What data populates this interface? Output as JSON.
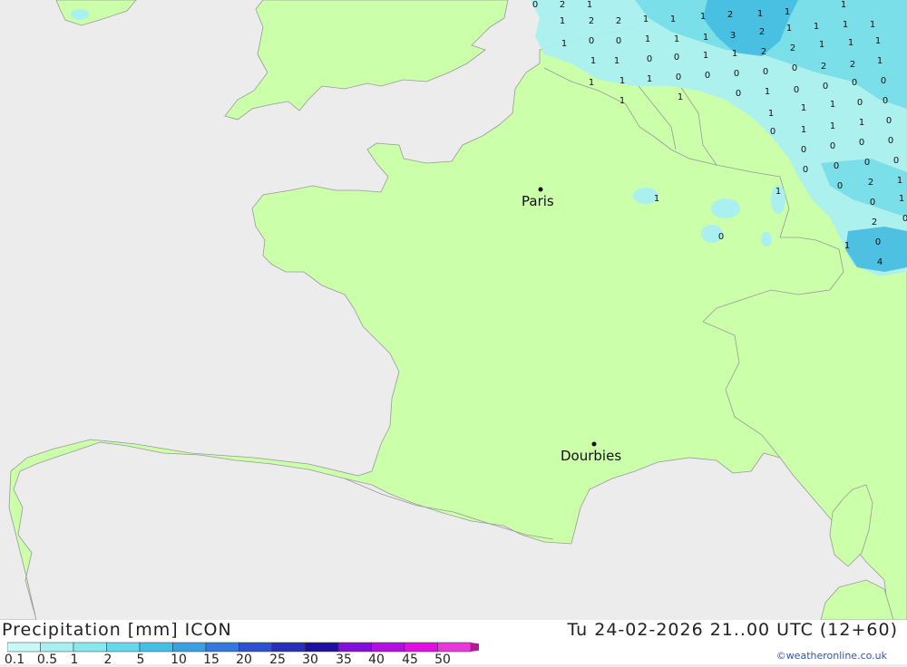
{
  "map": {
    "cities": [
      {
        "name": "Paris"
      },
      {
        "name": "Dourbies"
      }
    ],
    "precip_values": [
      "2",
      "1",
      "1",
      "2",
      "1",
      "1",
      "1",
      "2",
      "2",
      "1",
      "1",
      "0",
      "1",
      "1",
      "0",
      "0",
      "1",
      "1",
      "1",
      "3",
      "2",
      "1",
      "1",
      "1",
      "1",
      "1",
      "1",
      "0",
      "0",
      "1",
      "1",
      "2",
      "2",
      "1",
      "1",
      "1",
      "1",
      "1",
      "1",
      "0",
      "0",
      "0",
      "0",
      "0",
      "2",
      "2",
      "1",
      "1",
      "1",
      "0",
      "1",
      "0",
      "0",
      "0",
      "0",
      "1",
      "1",
      "1",
      "0",
      "0",
      "0",
      "1",
      "1",
      "1",
      "0",
      "0",
      "0",
      "0",
      "0",
      "0",
      "0",
      "0",
      "0",
      "0",
      "2",
      "1",
      "0",
      "1",
      "2",
      "0",
      "0",
      "4",
      "1",
      "1",
      "1",
      "0"
    ],
    "colors": {
      "land": "#ccffaa",
      "sea": "#ececec",
      "border": "#999999",
      "precip_light": "#aaf0f0",
      "precip_mid": "#77dde8",
      "precip_strong": "#44bbe0"
    }
  },
  "footer": {
    "title": "Precipitation [mm] ICON",
    "datetime": "Tu 24-02-2026 21..00 UTC (12+60)",
    "credit": "©weatheronline.co.uk"
  },
  "legend": {
    "ticks": [
      "0.1",
      "0.5",
      "1",
      "2",
      "5",
      "10",
      "15",
      "20",
      "25",
      "30",
      "35",
      "40",
      "45",
      "50"
    ],
    "colors": [
      "#c8f8f8",
      "#a8f0f0",
      "#88e8ee",
      "#66d8ea",
      "#44c0e4",
      "#3aa0e0",
      "#3478dc",
      "#2e50d0",
      "#2830b8",
      "#2010a0",
      "#8010d8",
      "#b010e0",
      "#e010e0",
      "#e838d8",
      "#b81898"
    ]
  }
}
